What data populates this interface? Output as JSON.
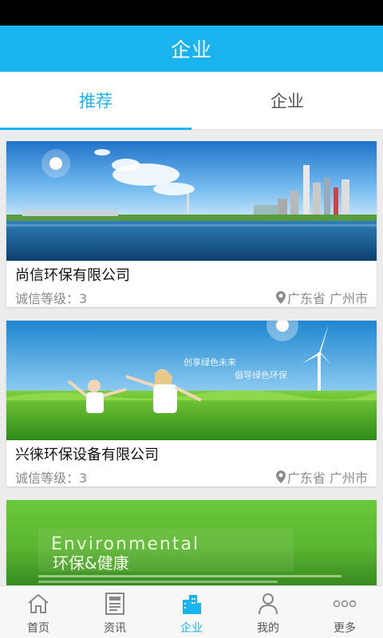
{
  "header": {
    "title": "企业"
  },
  "tabs": [
    {
      "label": "推荐",
      "active": true
    },
    {
      "label": "企业",
      "active": false
    }
  ],
  "companies": [
    {
      "name": "尚信环保有限公司",
      "credit": "诚信等级：3",
      "location": "广东省 广州市"
    },
    {
      "name": "兴徕环保设备有限公司",
      "credit": "诚信等级：3",
      "location": "广东省 广州市"
    },
    {
      "name": "",
      "credit": "",
      "location": ""
    }
  ],
  "banner_text": {
    "card2_line1": "创享绿色未来",
    "card2_line2": "倡导绿色环保",
    "card3_en": "Environmental",
    "card3_cn": "环保&健康"
  },
  "bottom_nav": [
    {
      "label": "首页",
      "icon": "home-icon",
      "active": false
    },
    {
      "label": "资讯",
      "icon": "news-icon",
      "active": false
    },
    {
      "label": "企业",
      "icon": "buildings-icon",
      "active": true
    },
    {
      "label": "我的",
      "icon": "person-icon",
      "active": false
    },
    {
      "label": "更多",
      "icon": "more-icon",
      "active": false
    }
  ],
  "colors": {
    "accent": "#19b4ef",
    "text": "#111111",
    "muted": "#8a8a8a"
  }
}
